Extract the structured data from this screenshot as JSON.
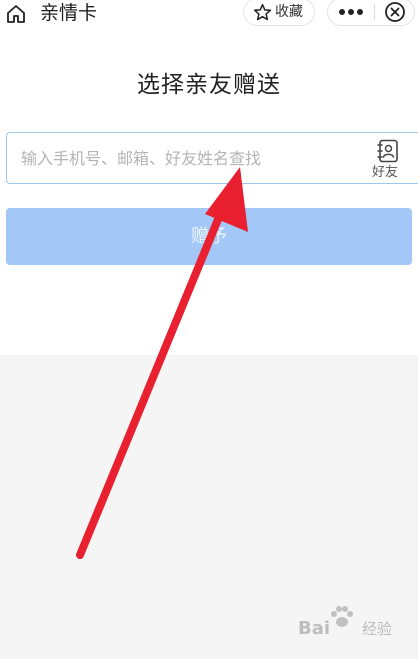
{
  "navbar": {
    "title": "亲情卡",
    "favorite_label": "收藏",
    "icons": [
      "home-icon",
      "star-icon",
      "more-icon",
      "close-icon"
    ]
  },
  "main": {
    "title": "选择亲友赠送",
    "search": {
      "placeholder": "输入手机号、邮箱、好友姓名查找",
      "value": ""
    },
    "contacts_label": "好友",
    "gift_button_label": "赠予"
  },
  "watermark": {
    "text": "Bai",
    "sub": "经验"
  },
  "colors": {
    "gift_button": "#a3c7f7",
    "search_border": "#9ec8ea",
    "arrow": "#e8202f",
    "page_bg": "#f5f5f5"
  }
}
